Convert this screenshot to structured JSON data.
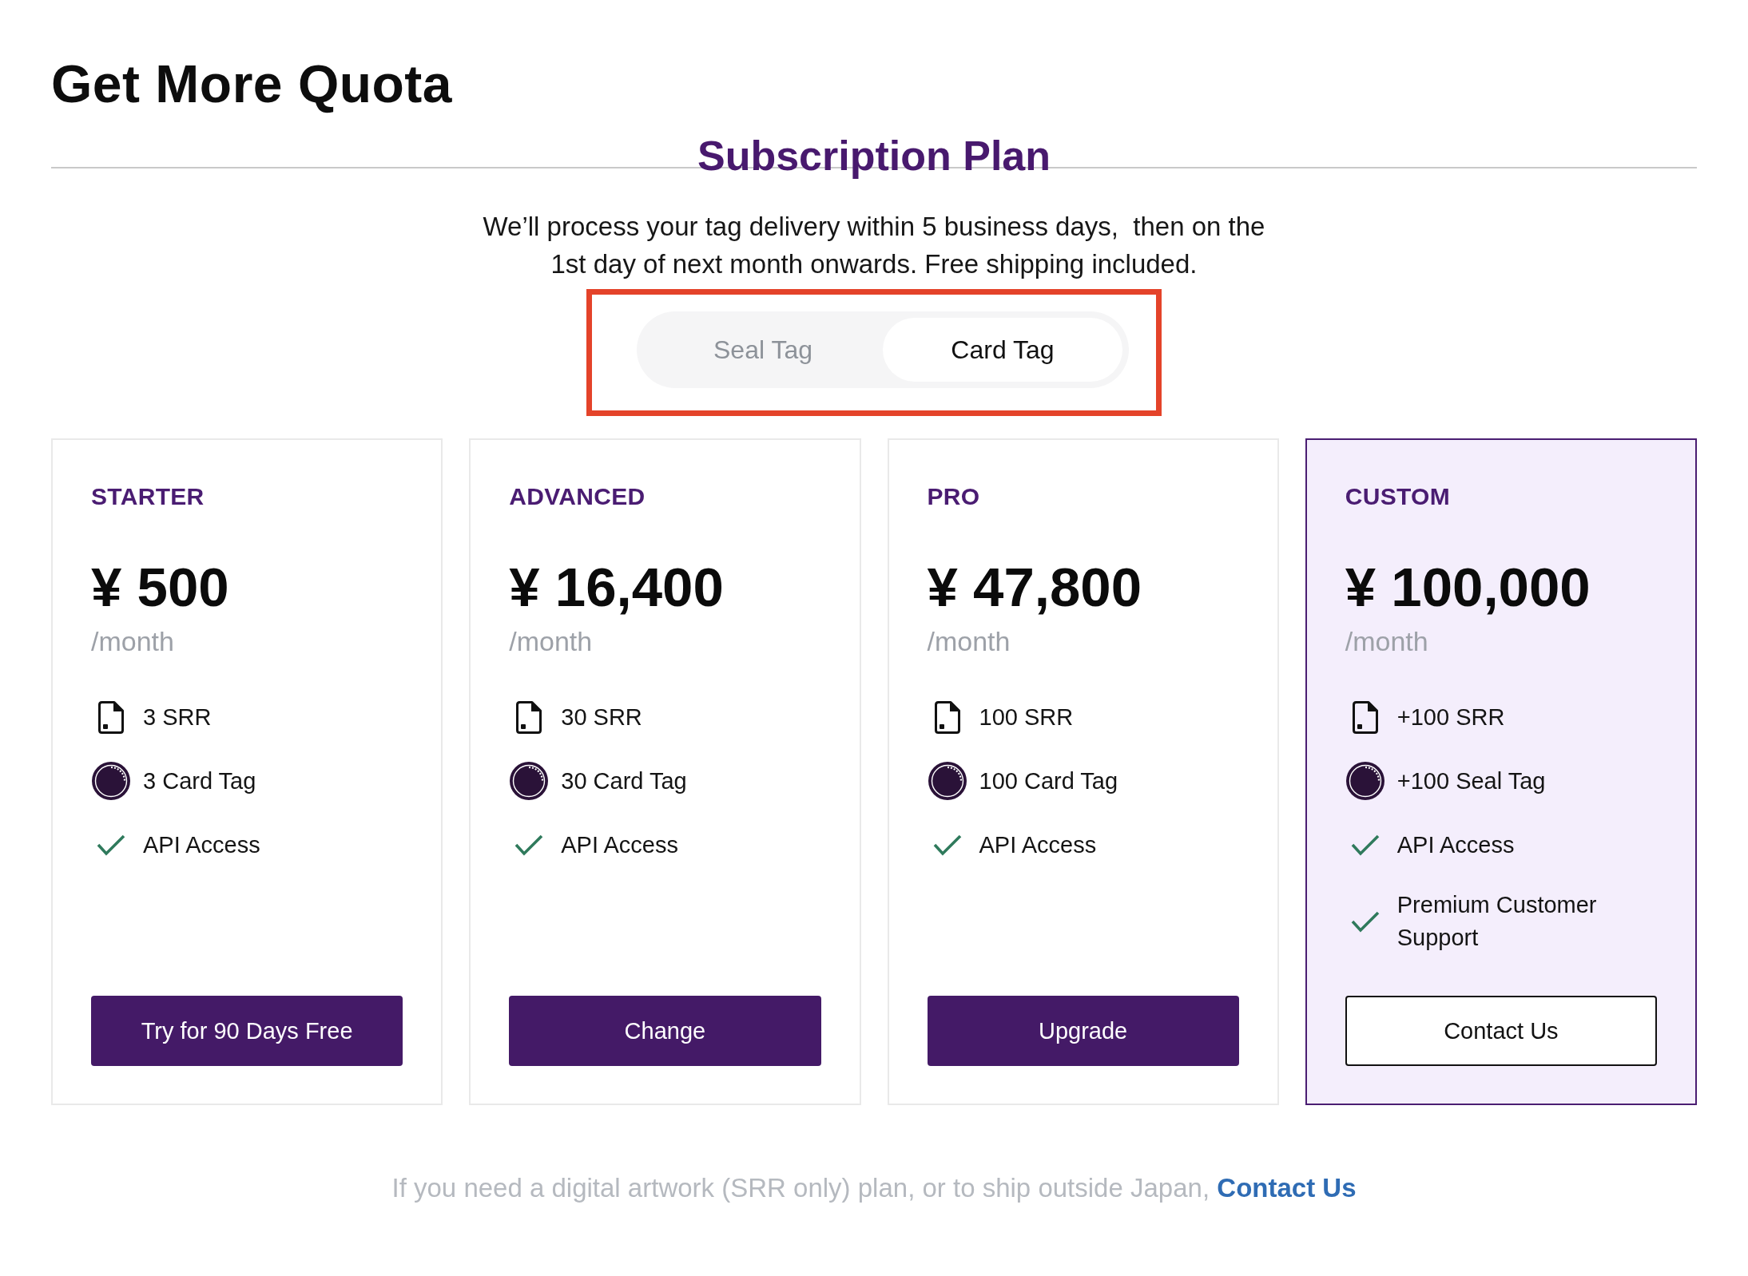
{
  "page_title": "Get More Quota",
  "section": {
    "title": "Subscription Plan",
    "description": "We’ll process your tag delivery within 5 business days,  then on the 1st day of next month onwards. Free shipping included."
  },
  "tag_toggle": {
    "highlighted": true,
    "options": [
      {
        "label": "Seal Tag",
        "selected": false
      },
      {
        "label": "Card Tag",
        "selected": true
      }
    ]
  },
  "plans": [
    {
      "name": "STARTER",
      "price": "¥ 500",
      "period": "/month",
      "highlighted": false,
      "features": [
        {
          "kind": "srr",
          "text": "3 SRR"
        },
        {
          "kind": "tag",
          "text": "3 Card Tag"
        },
        {
          "kind": "check",
          "text": "API Access"
        }
      ],
      "button": {
        "kind": "primary",
        "label": "Try for 90 Days Free"
      }
    },
    {
      "name": "ADVANCED",
      "price": "¥ 16,400",
      "period": "/month",
      "highlighted": false,
      "features": [
        {
          "kind": "srr",
          "text": "30 SRR"
        },
        {
          "kind": "tag",
          "text": "30 Card Tag"
        },
        {
          "kind": "check",
          "text": "API Access"
        }
      ],
      "button": {
        "kind": "primary",
        "label": "Change"
      }
    },
    {
      "name": "PRO",
      "price": "¥ 47,800",
      "period": "/month",
      "highlighted": false,
      "features": [
        {
          "kind": "srr",
          "text": "100 SRR"
        },
        {
          "kind": "tag",
          "text": "100 Card Tag"
        },
        {
          "kind": "check",
          "text": "API Access"
        }
      ],
      "button": {
        "kind": "primary",
        "label": "Upgrade"
      }
    },
    {
      "name": "CUSTOM",
      "price": "¥ 100,000",
      "period": "/month",
      "highlighted": true,
      "features": [
        {
          "kind": "srr",
          "text": "+100 SRR"
        },
        {
          "kind": "tag",
          "text": "+100 Seal Tag"
        },
        {
          "kind": "check",
          "text": "API Access"
        },
        {
          "kind": "check",
          "text": "Premium Customer Support"
        }
      ],
      "button": {
        "kind": "outline",
        "label": "Contact Us"
      }
    }
  ],
  "footer": {
    "text": "If you need a digital artwork (SRR only) plan, or to ship outside Japan,",
    "link": "Contact Us"
  }
}
